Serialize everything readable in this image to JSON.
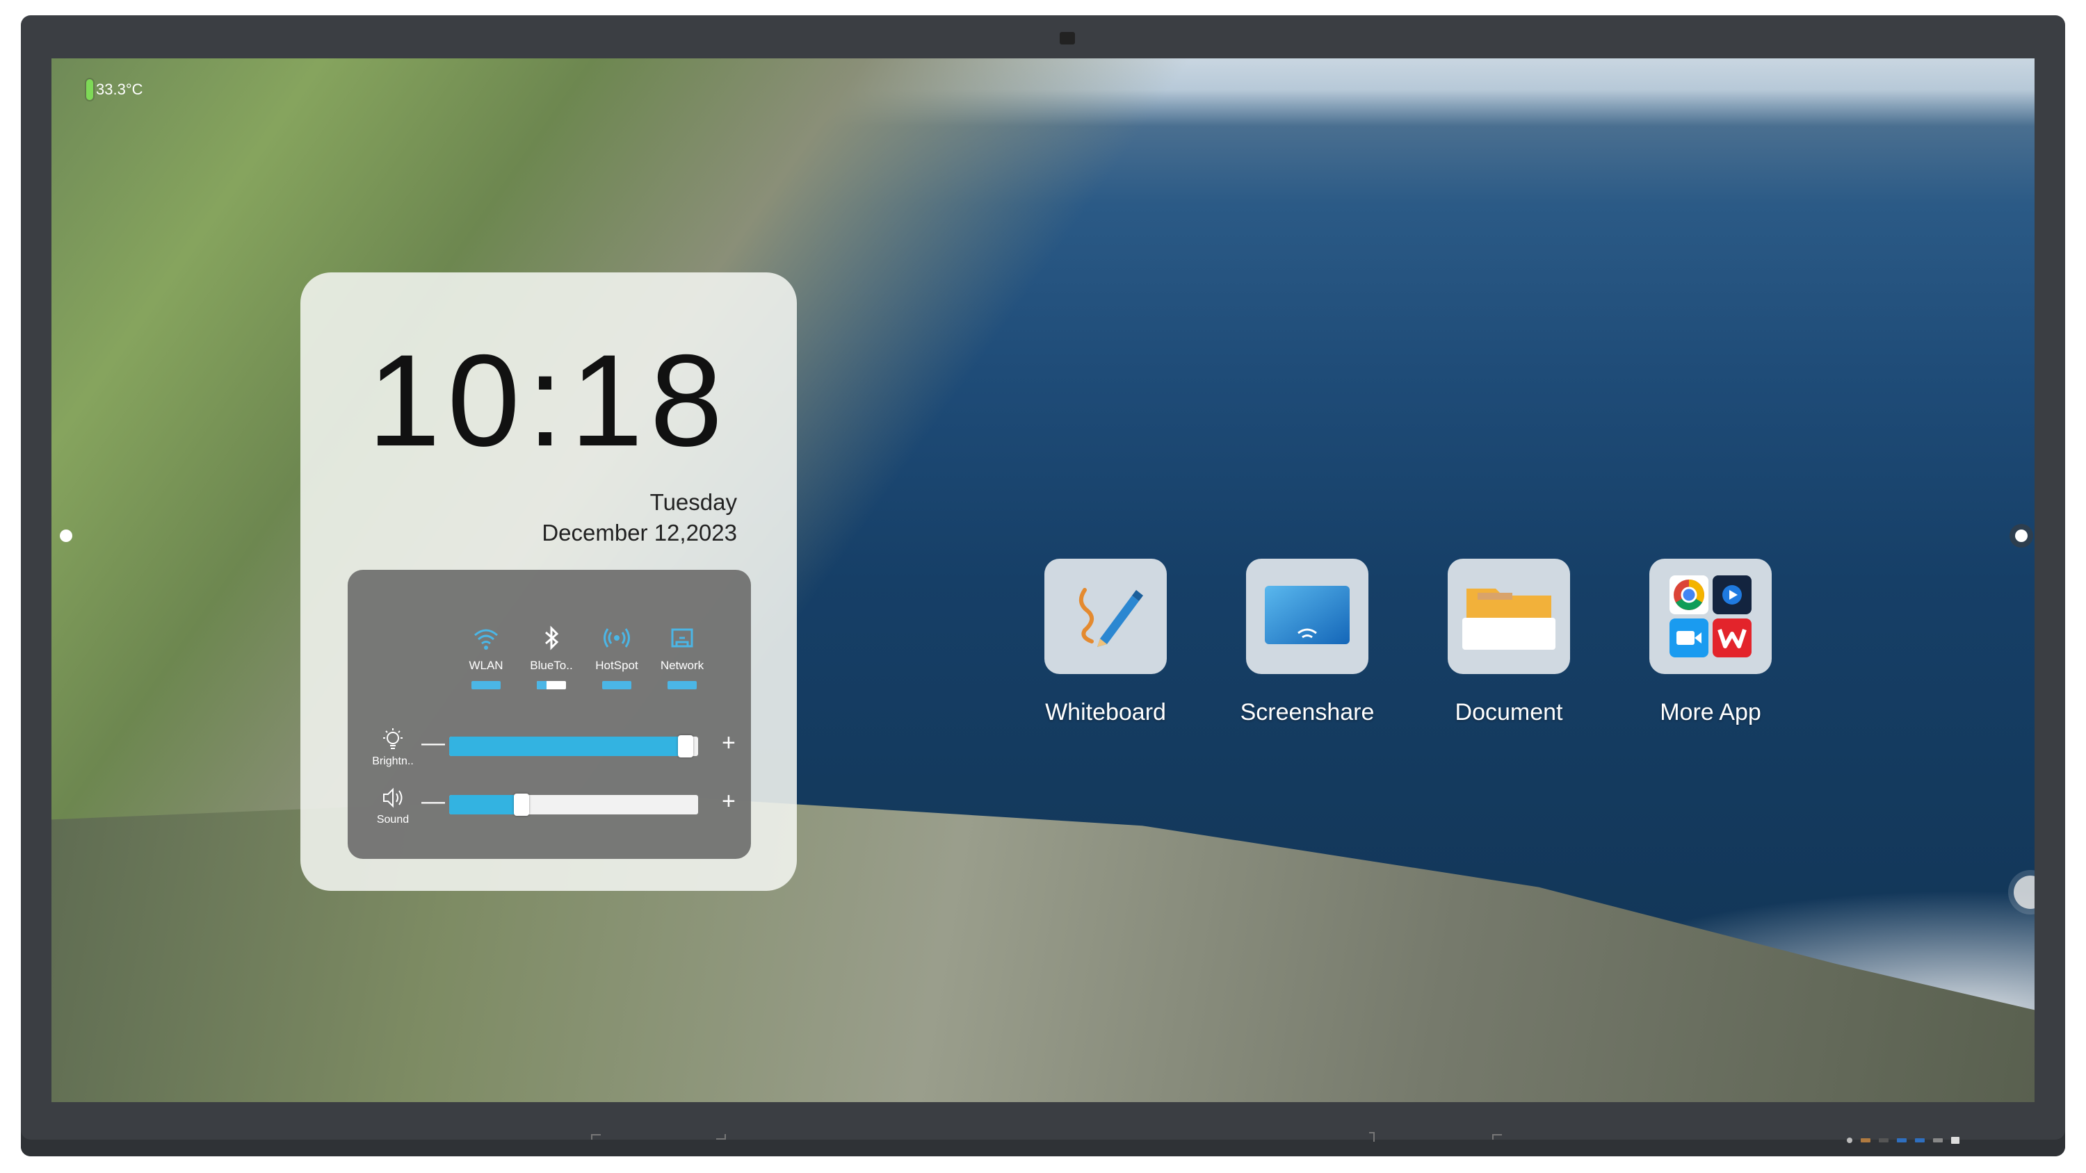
{
  "status": {
    "temperature": "33.3°C"
  },
  "clock": {
    "time": "10:18",
    "day": "Tuesday",
    "date": "December 12,2023"
  },
  "controls": {
    "toggles": [
      {
        "label": "WLAN",
        "state": "on"
      },
      {
        "label": "BlueTo..",
        "state": "off"
      },
      {
        "label": "HotSpot",
        "state": "on"
      },
      {
        "label": "Network",
        "state": "on"
      }
    ],
    "brightness": {
      "label": "Brightn..",
      "level_percent": 95
    },
    "sound": {
      "label": "Sound",
      "level_percent": 29
    },
    "minus_symbol": "—",
    "plus_symbol": "+"
  },
  "apps": [
    {
      "label": "Whiteboard",
      "icon": "whiteboard-pen-icon"
    },
    {
      "label": "Screenshare",
      "icon": "screenshare-icon"
    },
    {
      "label": "Document",
      "icon": "document-folder-icon"
    },
    {
      "label": "More App",
      "icon": "more-apps-grid-icon"
    }
  ],
  "colors": {
    "accent": "#33b3e1",
    "bezel": "#3b3e43"
  }
}
